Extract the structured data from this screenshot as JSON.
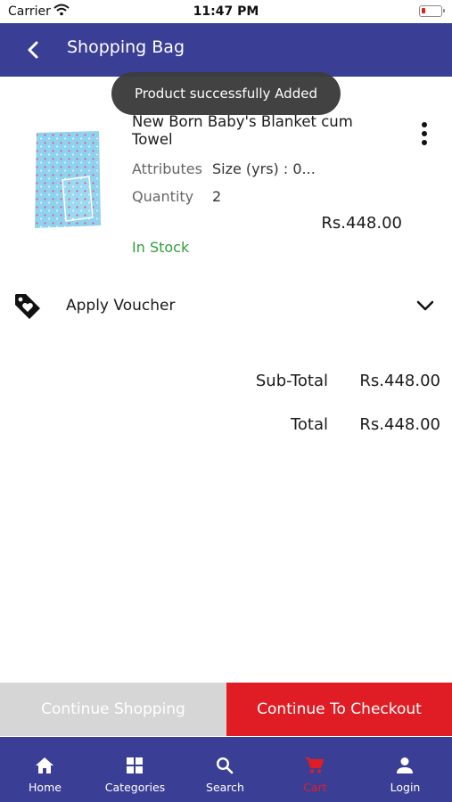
{
  "status_bar": {
    "carrier": "Carrier",
    "time": "11:47 PM"
  },
  "header": {
    "title": "Shopping Bag",
    "back_icon": "chevron-left-icon"
  },
  "toast": {
    "message": "Product successfully Added"
  },
  "product": {
    "name": "New Born Baby's Blanket cum Towel",
    "attributes_label": "Attributes",
    "attributes_value": "Size (yrs) : 0...",
    "quantity_label": "Quantity",
    "quantity_value": "2",
    "price": "Rs.448.00",
    "stock": "In Stock",
    "menu_icon": "more-vertical-icon"
  },
  "voucher": {
    "label": "Apply Voucher",
    "icon": "tag-heart-icon",
    "expand_icon": "chevron-down-icon"
  },
  "totals": {
    "subtotal_label": "Sub-Total",
    "subtotal_value": "Rs.448.00",
    "total_label": "Total",
    "total_value": "Rs.448.00"
  },
  "actions": {
    "continue_shopping": "Continue Shopping",
    "checkout": "Continue To Checkout"
  },
  "tab_bar": {
    "items": [
      {
        "label": "Home",
        "icon": "home-icon"
      },
      {
        "label": "Categories",
        "icon": "grid-icon"
      },
      {
        "label": "Search",
        "icon": "search-icon"
      },
      {
        "label": "Cart",
        "icon": "cart-icon",
        "active": true
      },
      {
        "label": "Login",
        "icon": "person-icon"
      }
    ]
  },
  "colors": {
    "brand": "#3b3e95",
    "accent": "#e01d25",
    "in_stock": "#2e9e3a",
    "disabled_button": "#d6d6d6",
    "toast_bg": "#3c3c3c"
  }
}
